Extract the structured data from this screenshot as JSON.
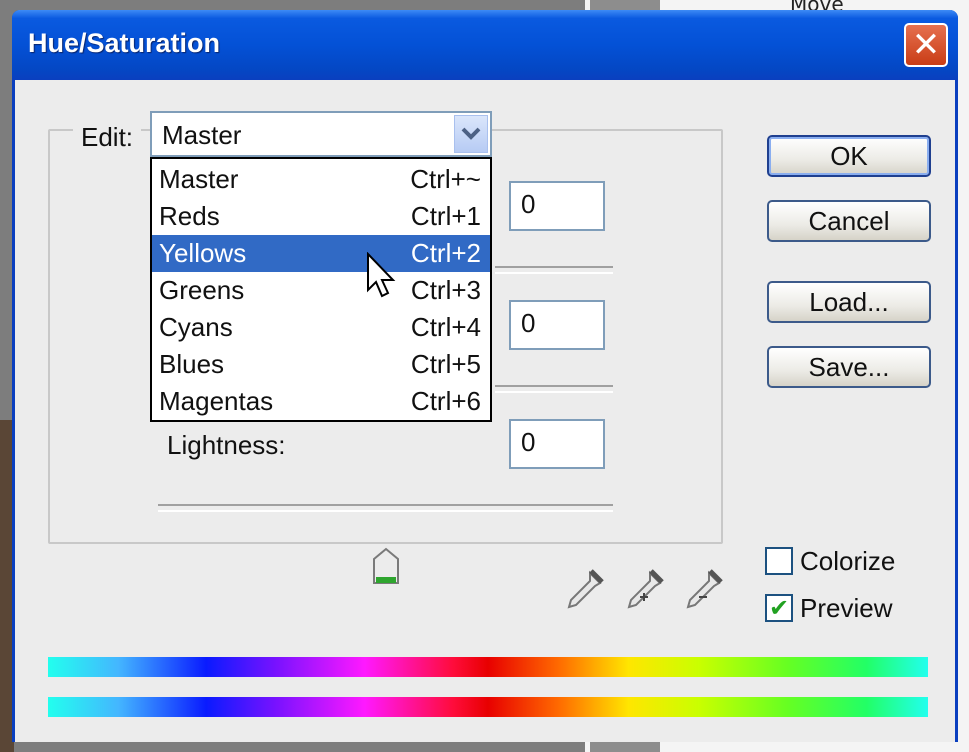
{
  "dialog": {
    "title": "Hue/Saturation",
    "close_glyph": "✕"
  },
  "background": {
    "partial_text": "Move"
  },
  "edit": {
    "label": "Edit:",
    "selected": "Master",
    "options": [
      {
        "name": "Master",
        "shortcut": "Ctrl+~"
      },
      {
        "name": "Reds",
        "shortcut": "Ctrl+1"
      },
      {
        "name": "Yellows",
        "shortcut": "Ctrl+2"
      },
      {
        "name": "Greens",
        "shortcut": "Ctrl+3"
      },
      {
        "name": "Cyans",
        "shortcut": "Ctrl+4"
      },
      {
        "name": "Blues",
        "shortcut": "Ctrl+5"
      },
      {
        "name": "Magentas",
        "shortcut": "Ctrl+6"
      }
    ],
    "highlighted_option": "Yellows"
  },
  "hue": {
    "value": "0"
  },
  "saturation": {
    "value": "0"
  },
  "lightness": {
    "label": "Lightness:",
    "value": "0",
    "slider_fraction": 0.5
  },
  "buttons": {
    "ok": "OK",
    "cancel": "Cancel",
    "load": "Load...",
    "save": "Save..."
  },
  "checkboxes": {
    "colorize": {
      "label": "Colorize",
      "checked": false
    },
    "preview": {
      "label": "Preview",
      "checked": true,
      "glyph": "✔"
    }
  },
  "icons": [
    "eyedropper-icon",
    "eyedropper-plus-icon",
    "eyedropper-minus-icon",
    "dropdown-chevron-icon",
    "close-icon",
    "mouse-pointer-icon"
  ],
  "colors": {
    "titlebar": "#0451d6",
    "selection": "#316ac5",
    "close_button": "#d9532d"
  }
}
